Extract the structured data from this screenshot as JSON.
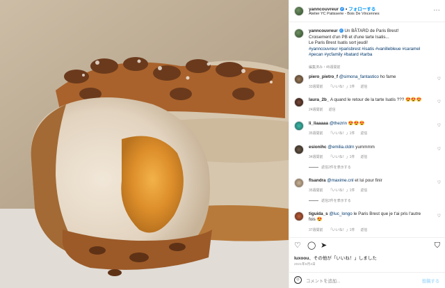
{
  "post": {
    "username": "yanncouvreur",
    "verified_icon": "verified-badge-icon",
    "separator": "•",
    "follow_label": "フォローする",
    "location": "Atelier YC Patisserie - Bois De Vincennes",
    "more_icon": "more-options-icon",
    "more_glyph": "···"
  },
  "caption": {
    "username": "yanncouvreur",
    "lines": [
      "Un BÂTARD de Paris Brest!",
      "Croisement d'un PB et d'une tarte Isatis...",
      "Le Paris Brest Isatis sort jeudi!"
    ],
    "hashtags": [
      "#yanncouvreur #parisbrest #isatis #vanillebleue #caramel",
      "#pecan #ycfamily #batard #tarba"
    ],
    "meta": "編集済み・45週間前"
  },
  "comments": [
    {
      "username": "piero_pietro_f",
      "mention": "@simona_fantastico",
      "text": " ho fame",
      "time": "33週間前",
      "likes": "「いいね！」1件",
      "reply": "返信",
      "replies": ""
    },
    {
      "username": "laura_2b_",
      "mention": "",
      "text": "A quand le retour de la tarte Isatis ??? 😍😍😍",
      "time": "24週間前",
      "likes": "",
      "reply": "返信",
      "replies": ""
    },
    {
      "username": "li_liaaaaa",
      "mention": "@thezrin",
      "text": " 😍😍😍",
      "time": "35週間前",
      "likes": "「いいね！」1件",
      "reply": "返信",
      "replies": ""
    },
    {
      "username": "esionihc",
      "mention": "@emilia.cldrn",
      "text": " yummmm",
      "time": "34週間前",
      "likes": "「いいね！」1件",
      "reply": "返信",
      "replies": "返信2件を表示する"
    },
    {
      "username": "flsandra",
      "mention": "@maxime.cnl",
      "text": " et lui pour finir",
      "time": "35週間前",
      "likes": "「いいね！」1件",
      "reply": "返信",
      "replies": "返信2件を表示する"
    },
    {
      "username": "tiguida_s",
      "mention": "@luc_longo",
      "text": " le Paris Brest que je t'ai pris l'autre fois 😍",
      "time": "37週間前",
      "likes": "「いいね！」1件",
      "reply": "返信",
      "replies": ""
    }
  ],
  "actions": {
    "like_icon": "heart-icon",
    "comment_icon": "comment-icon",
    "share_icon": "share-icon",
    "save_icon": "bookmark-icon",
    "like_glyph": "♡",
    "comment_glyph": "◯",
    "share_glyph": "➤",
    "save_glyph": "⛉"
  },
  "likes": {
    "user": "luxoou",
    "suffix": "、その他が「いいね！」しました"
  },
  "date": "2021年5月4日",
  "add_comment": {
    "emoji_glyph": "☺",
    "placeholder": "コメントを追加...",
    "post_label": "投稿する"
  },
  "colors": {
    "link": "#0095f6",
    "hashtag": "#00376b",
    "muted": "#8e8e8e",
    "post_disabled": "#b2dffc"
  }
}
